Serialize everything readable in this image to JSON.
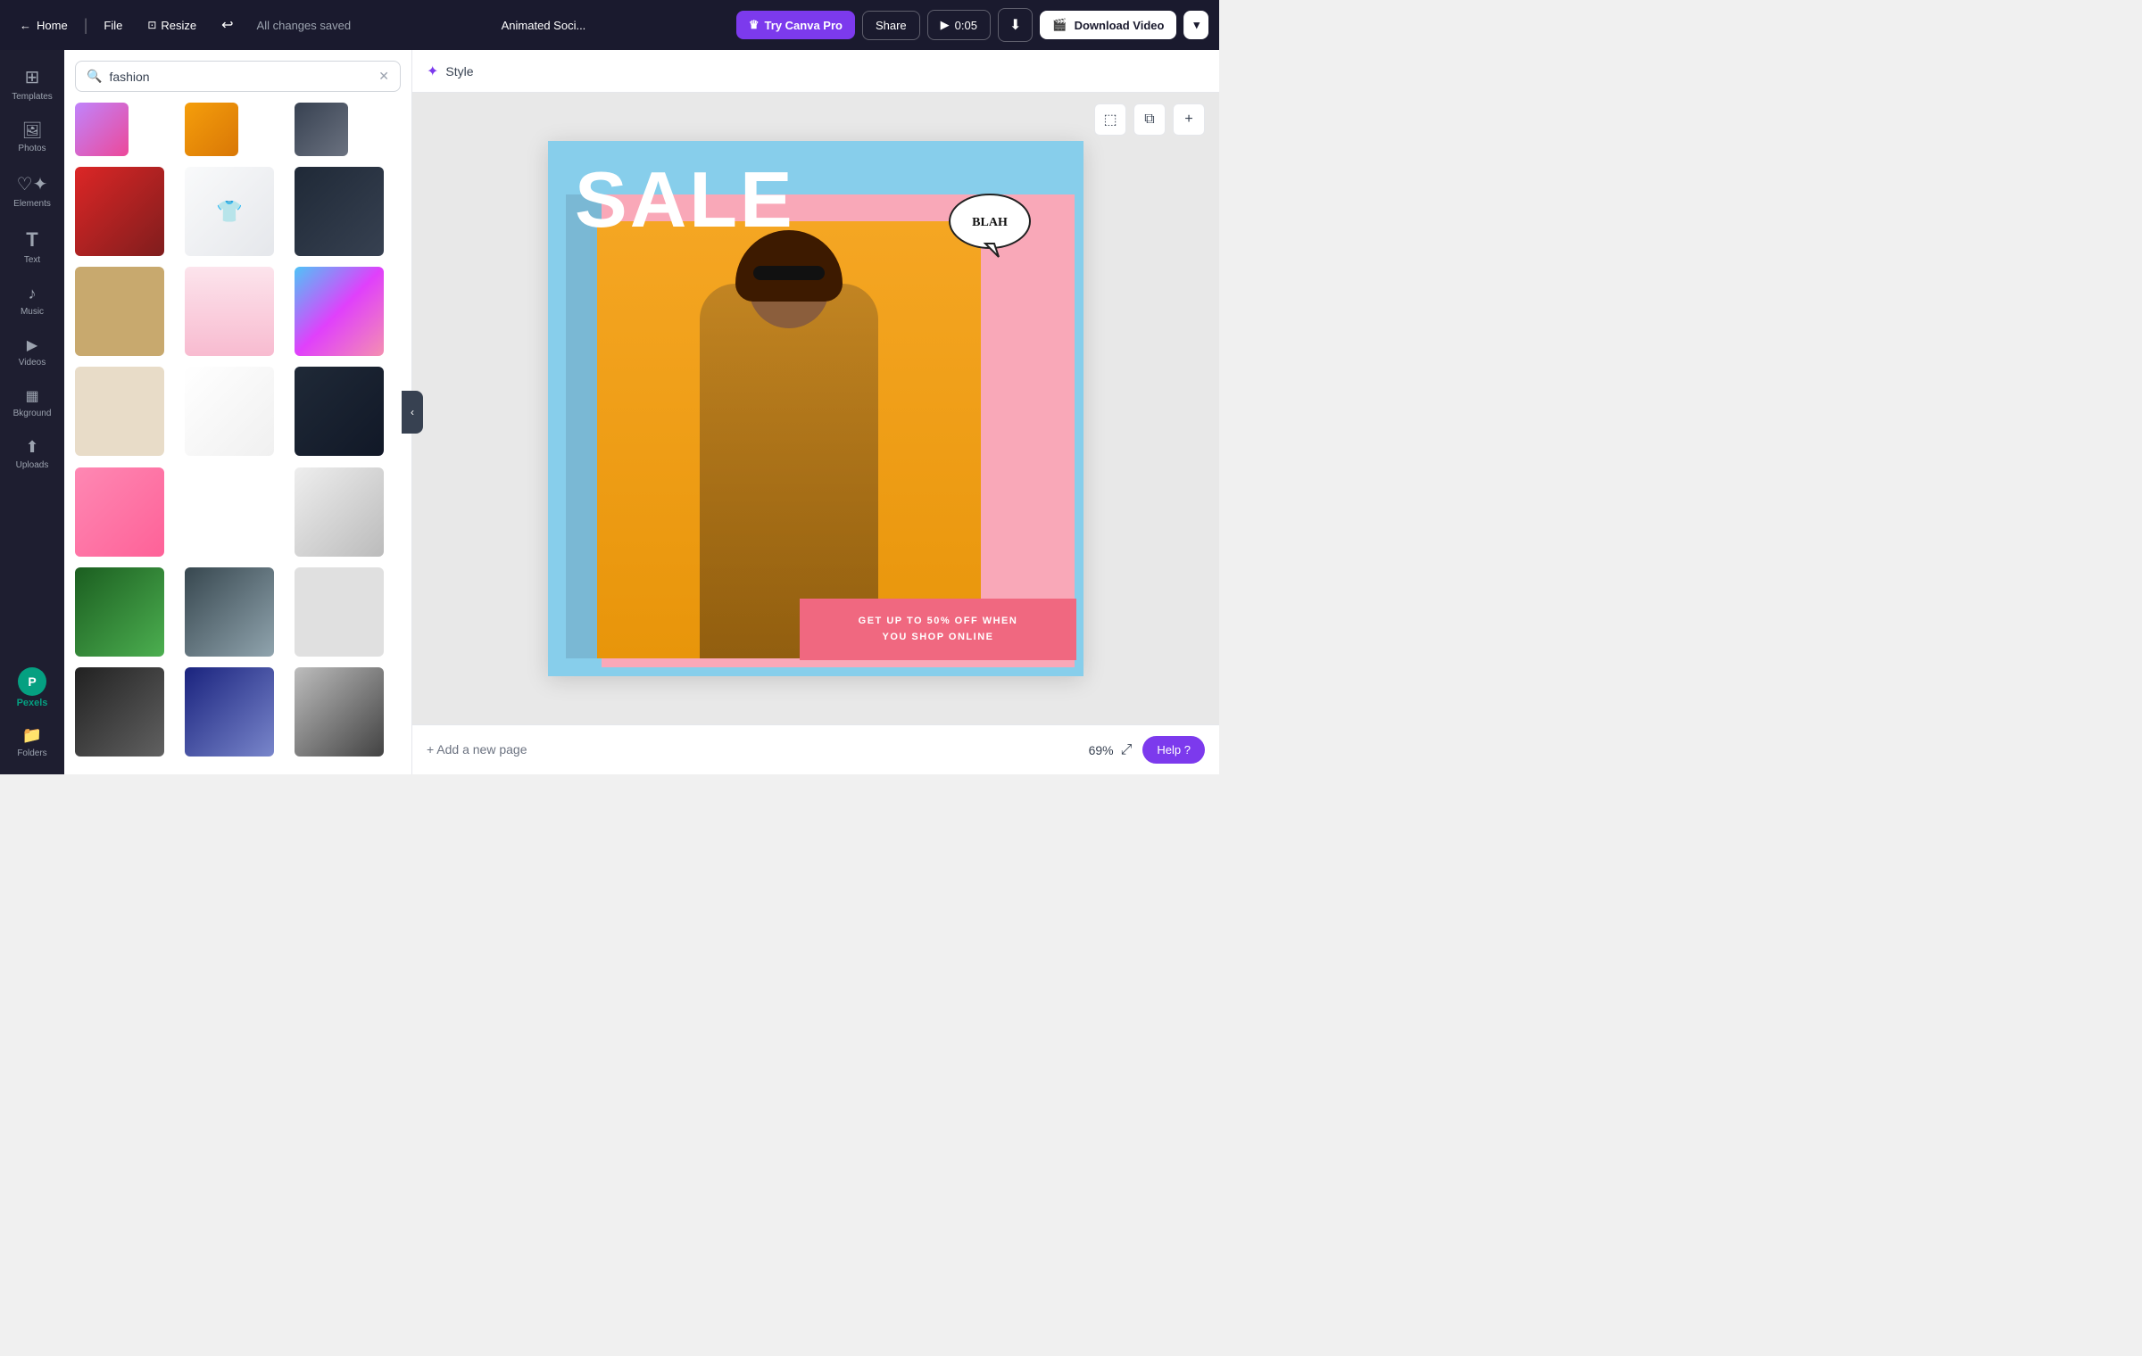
{
  "topbar": {
    "home_label": "Home",
    "file_label": "File",
    "resize_label": "Resize",
    "status": "All changes saved",
    "project_title": "Animated Soci...",
    "try_pro_label": "Try Canva Pro",
    "share_label": "Share",
    "play_time": "0:05",
    "download_video_label": "Download Video",
    "home_icon": "←",
    "crown_icon": "♛"
  },
  "sidebar": {
    "items": [
      {
        "label": "Templates",
        "icon": "⊞"
      },
      {
        "label": "Photos",
        "icon": "🖼"
      },
      {
        "label": "Elements",
        "icon": "♡"
      },
      {
        "label": "Text",
        "icon": "T"
      },
      {
        "label": "Music",
        "icon": "♪"
      },
      {
        "label": "Videos",
        "icon": "▶"
      },
      {
        "label": "Bkground",
        "icon": "▦"
      },
      {
        "label": "Uploads",
        "icon": "↑"
      },
      {
        "label": "Folders",
        "icon": "📁"
      }
    ]
  },
  "search": {
    "placeholder": "fashion",
    "clear_icon": "✕",
    "search_icon": "🔍"
  },
  "style_bar": {
    "label": "Style",
    "magic_icon": "✦"
  },
  "canvas": {
    "sale_text": "SALE",
    "blah_text": "BLAH",
    "bottom_line1": "GET UP TO 50% OFF WHEN",
    "bottom_line2": "YOU SHOP ONLINE",
    "add_page_label": "+ Add a new page",
    "zoom_level": "69%"
  },
  "canvas_tools": {
    "frame_icon": "⬚",
    "copy_icon": "⧉",
    "add_icon": "+"
  },
  "bottom": {
    "add_page": "+ Add a new page",
    "zoom": "69%",
    "expand_icon": "⤢",
    "help_label": "Help ?",
    "question_icon": "?"
  },
  "pexels": {
    "label": "Pexels",
    "letter": "P"
  }
}
